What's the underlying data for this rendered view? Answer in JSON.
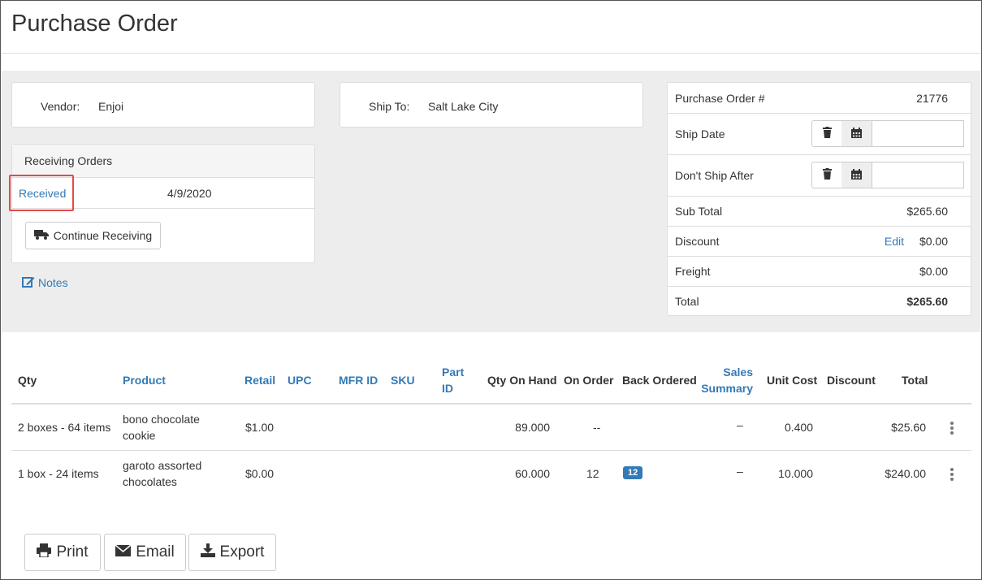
{
  "page": {
    "title": "Purchase Order"
  },
  "vendor": {
    "label": "Vendor:",
    "value": "Enjoi"
  },
  "ship_to": {
    "label": "Ship To:",
    "value": "Salt Lake City"
  },
  "receiving": {
    "header": "Receiving Orders",
    "status_link": "Received",
    "date": "4/9/2020",
    "continue_label": "Continue Receiving"
  },
  "notes_label": "Notes",
  "summary": {
    "po_label": "Purchase Order #",
    "po_number": "21776",
    "ship_date_label": "Ship Date",
    "dont_ship_after_label": "Don't Ship After",
    "subtotal_label": "Sub Total",
    "subtotal": "$265.60",
    "discount_label": "Discount",
    "discount_edit": "Edit",
    "discount": "$0.00",
    "freight_label": "Freight",
    "freight": "$0.00",
    "total_label": "Total",
    "total": "$265.60"
  },
  "table": {
    "headers": {
      "qty": "Qty",
      "product": "Product",
      "retail": "Retail",
      "upc": "UPC",
      "mfr_id": "MFR ID",
      "sku": "SKU",
      "part_id_1": "Part",
      "part_id_2": "ID",
      "qty_on_hand": "Qty On Hand",
      "on_order": "On Order",
      "back_ordered": "Back Ordered",
      "sales_summary_1": "Sales",
      "sales_summary_2": "Summary",
      "unit_cost": "Unit Cost",
      "discount": "Discount",
      "total": "Total"
    },
    "rows": [
      {
        "qty": "2 boxes - 64 items",
        "product_1": "bono chocolate",
        "product_2": "cookie",
        "retail": "$1.00",
        "qty_on_hand": "89.000",
        "on_order": "--",
        "back_ordered": "",
        "sales_summary": "–",
        "unit_cost": "0.400",
        "total": "$25.60"
      },
      {
        "qty": "1 box - 24 items",
        "product_1": "garoto assorted",
        "product_2": "chocolates",
        "retail": "$0.00",
        "qty_on_hand": "60.000",
        "on_order": "12",
        "back_ordered": "12",
        "sales_summary": "–",
        "unit_cost": "10.000",
        "total": "$240.00"
      }
    ]
  },
  "actions": {
    "print": "Print",
    "email": "Email",
    "export": "Export"
  },
  "colors": {
    "link": "#337ab7",
    "highlight": "#e34a4a",
    "band": "#ededed"
  },
  "icons": [
    "truck-icon",
    "edit-icon",
    "trash-icon",
    "calendar-icon",
    "print-icon",
    "envelope-icon",
    "download-icon",
    "kebab-icon"
  ]
}
